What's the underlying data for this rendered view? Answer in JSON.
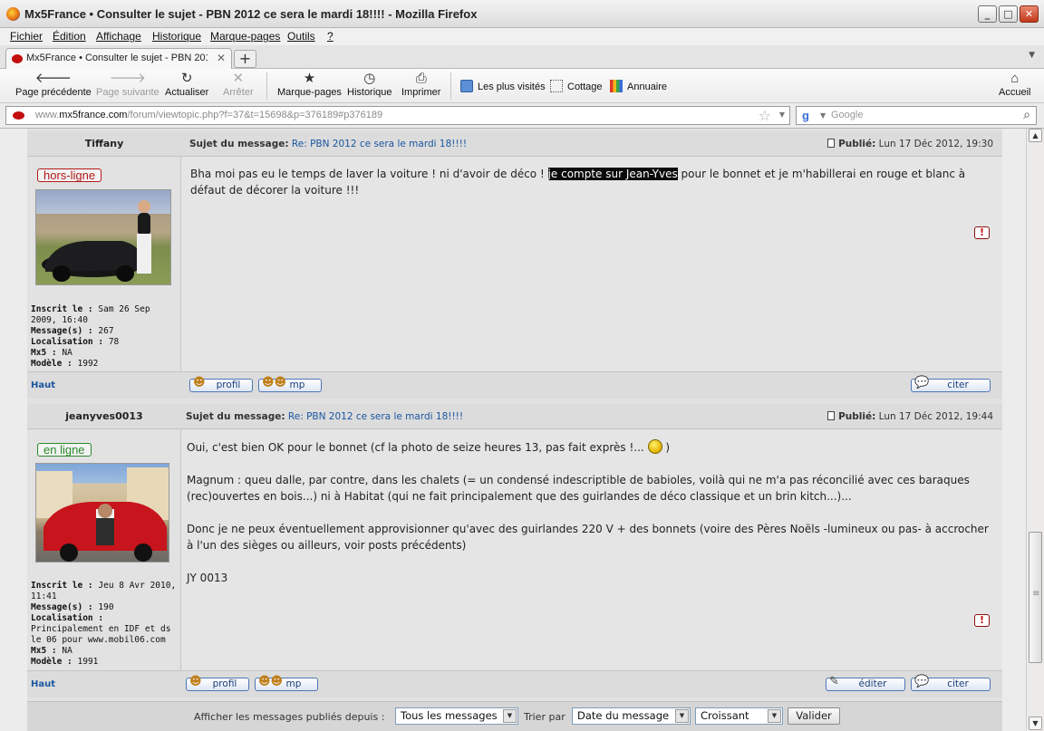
{
  "window": {
    "title": "Mx5France • Consulter le sujet - PBN 2012 ce sera le mardi 18!!!! - Mozilla Firefox",
    "minimize": "_",
    "maximize": "□",
    "close": "✕"
  },
  "menu": [
    "Fichier",
    "Édition",
    "Affichage",
    "Historique",
    "Marque-pages",
    "Outils",
    "?"
  ],
  "tab": {
    "label": "Mx5France • Consulter le sujet - PBN 2012 c...",
    "close": "✕",
    "new_tab": "+"
  },
  "toolbar": {
    "back": "Page précédente",
    "forward": "Page suivante",
    "reload": "Actualiser",
    "stop": "Arrêter",
    "bookmarks": "Marque-pages",
    "history": "Historique",
    "print": "Imprimer",
    "most_visited": "Les plus visités",
    "cottage": "Cottage",
    "annuaire": "Annuaire",
    "home": "Accueil"
  },
  "url": {
    "prefix": "www.",
    "domain": "mx5france.com",
    "path": "/forum/viewtopic.php?f=37&t=15698&p=376189#p376189"
  },
  "search": {
    "engine_icon": "g",
    "placeholder": "Google"
  },
  "posts": [
    {
      "author": "Tiffany",
      "subject_label": "Sujet du message:",
      "subject": "Re: PBN 2012 ce sera le mardi 18!!!!",
      "posted_label": "Publié:",
      "posted": "Lun 17 Déc 2012, 19:30",
      "status": "hors-ligne",
      "info": {
        "inscrit_label": "Inscrit le :",
        "inscrit": "Sam 26 Sep 2009, 16:40",
        "messages_label": "Message(s) :",
        "messages": "267",
        "localisation_label": "Localisation :",
        "localisation": "78",
        "mx5_label": "Mx5 :",
        "mx5": "NA",
        "modele_label": "Modèle :",
        "modele": "1992"
      },
      "text_before": "Bha moi pas eu le temps de laver la voiture ! ni d'avoir de déco ! ",
      "text_highlight": "je compte sur Jean-Yves",
      "text_after": " pour le bonnet et je m'habillerai en rouge et blanc à défaut de décorer la voiture !!!",
      "report": "!",
      "haut": "Haut",
      "btn_profil": "profil",
      "btn_mp": "mp",
      "btn_citer": "citer"
    },
    {
      "author": "jeanyves0013",
      "subject_label": "Sujet du message:",
      "subject": "Re: PBN 2012 ce sera le mardi 18!!!!",
      "posted_label": "Publié:",
      "posted": "Lun 17 Déc 2012, 19:44",
      "status": "en ligne",
      "info": {
        "inscrit_label": "Inscrit le :",
        "inscrit": "Jeu 8 Avr 2010, 11:41",
        "messages_label": "Message(s) :",
        "messages": "190",
        "localisation_label": "Localisation :",
        "localisation": "Principalement en IDF et ds le 06 pour www.mobil06.com",
        "mx5_label": "Mx5 :",
        "mx5": "NA",
        "modele_label": "Modèle :",
        "modele": "1991"
      },
      "p1_before": "Oui, c'est bien OK pour le bonnet (cf la photo de seize heures 13, pas fait exprès !... ",
      "p1_after": " )",
      "p2": "Magnum : queu dalle, par contre, dans les chalets (= un condensé indescriptible de babioles, voilà qui ne m'a pas réconcilié avec ces baraques (rec)ouvertes en bois...) ni à Habitat (qui ne fait principalement que des guirlandes de déco classique et un brin kitch...)...",
      "p3": "Donc je ne peux éventuellement approvisionner qu'avec des guirlandes 220 V + des bonnets (voire des Pères Noëls -lumineux ou pas- à accrocher à l'un des sièges ou ailleurs, voir posts précédents)",
      "p4": "JY 0013",
      "report": "!",
      "haut": "Haut",
      "btn_profil": "profil",
      "btn_mp": "mp",
      "btn_editer": "éditer",
      "btn_citer": "citer"
    }
  ],
  "filter": {
    "label": "Afficher les messages publiés depuis :",
    "period": "Tous les messages",
    "sort_label": "Trier par",
    "sort_by": "Date du message",
    "order": "Croissant",
    "submit": "Valider"
  }
}
